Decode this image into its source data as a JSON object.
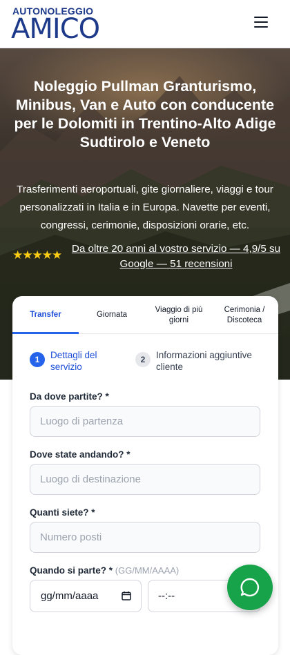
{
  "header": {
    "logo_top": "AUTONOLEGGIO",
    "logo_main_left": "A",
    "logo_main_mid": "MI",
    "logo_main_right": "CO",
    "menu_icon": "hamburger-menu-icon"
  },
  "hero": {
    "title": "Noleggio Pullman Granturismo, Minibus, Van e Auto con conducente per le Dolomiti in Trentino-Alto Adige Sudtirolo e Veneto",
    "subtitle": "Trasferimenti aeroportuali, gite giornaliere, viaggi e tour personalizzati in Italia e in Europa. Navette per eventi, congressi, cerimonie, disposizioni orarie, etc.",
    "stars": "★★★★★",
    "rating_value": 4.9,
    "rating_max": 5,
    "rating_link": "Da oltre 20 anni al vostro servizio — 4,9/5 su Google — 51 recensioni"
  },
  "form": {
    "tabs": [
      {
        "label": "Transfer",
        "active": true
      },
      {
        "label": "Giornata",
        "active": false
      },
      {
        "label": "Viaggio di più giorni",
        "active": false
      },
      {
        "label": "Cerimonia / Discoteca",
        "active": false
      }
    ],
    "steps": [
      {
        "number": "1",
        "label": "Dettagli del servizio",
        "active": true
      },
      {
        "number": "2",
        "label": "Informazioni aggiuntive cliente",
        "active": false
      }
    ],
    "from_label": "Da dove partite? *",
    "from_placeholder": "Luogo di partenza",
    "to_label": "Dove state andando? *",
    "to_placeholder": "Luogo di destinazione",
    "people_label": "Quanti siete? *",
    "people_placeholder": "Numero posti",
    "when_label": "Quando si parte? *",
    "when_hint": "(GG/MM/AAAA)",
    "date_value": "gg/mm/aaaa",
    "time_value": "--:--"
  },
  "floating": {
    "whatsapp_icon": "whatsapp-chat-icon"
  },
  "colors": {
    "brand_blue": "#1e3a8a",
    "accent_blue": "#2563eb",
    "whatsapp_green": "#16a34a",
    "star_yellow": "#facc15"
  }
}
